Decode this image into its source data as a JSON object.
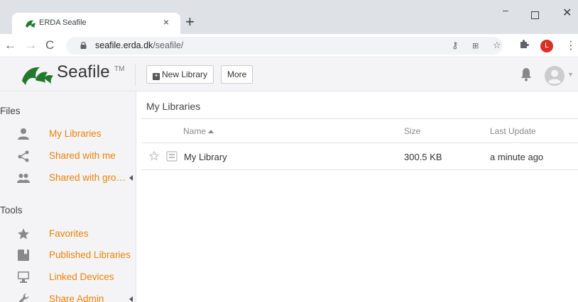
{
  "browser": {
    "tab_title": "ERDA Seafile",
    "tab_close": "×",
    "new_tab": "+",
    "url_host": "seafile.erda.dk",
    "url_path": "/seafile/",
    "profile_initial": "L",
    "window_minimize": "–",
    "window_close": "✕",
    "back": "←",
    "forward": "→",
    "reload": "C",
    "menu": "⋮"
  },
  "header": {
    "brand": "Seafile",
    "brand_tm": "TM",
    "new_library_label": "New Library",
    "more_label": "More"
  },
  "sidebar": {
    "files_heading": "Files",
    "files_items": [
      {
        "label": "My Libraries",
        "icon": "user-icon"
      },
      {
        "label": "Shared with me",
        "icon": "share-icon"
      },
      {
        "label": "Shared with gro…",
        "icon": "group-icon"
      }
    ],
    "tools_heading": "Tools",
    "tools_items": [
      {
        "label": "Favorites",
        "icon": "star-icon"
      },
      {
        "label": "Published Libraries",
        "icon": "book-icon"
      },
      {
        "label": "Linked Devices",
        "icon": "monitor-icon"
      },
      {
        "label": "Share Admin",
        "icon": "wrench-icon"
      }
    ]
  },
  "main": {
    "title": "My Libraries",
    "columns": {
      "name": "Name",
      "size": "Size",
      "last_update": "Last Update"
    },
    "rows": [
      {
        "name": "My Library",
        "size": "300.5 KB",
        "last_update": "a minute ago"
      }
    ]
  },
  "colors": {
    "accent_orange": "#eb8205",
    "logo_green": "#22792b",
    "panel_bg": "#f4f4f7"
  }
}
